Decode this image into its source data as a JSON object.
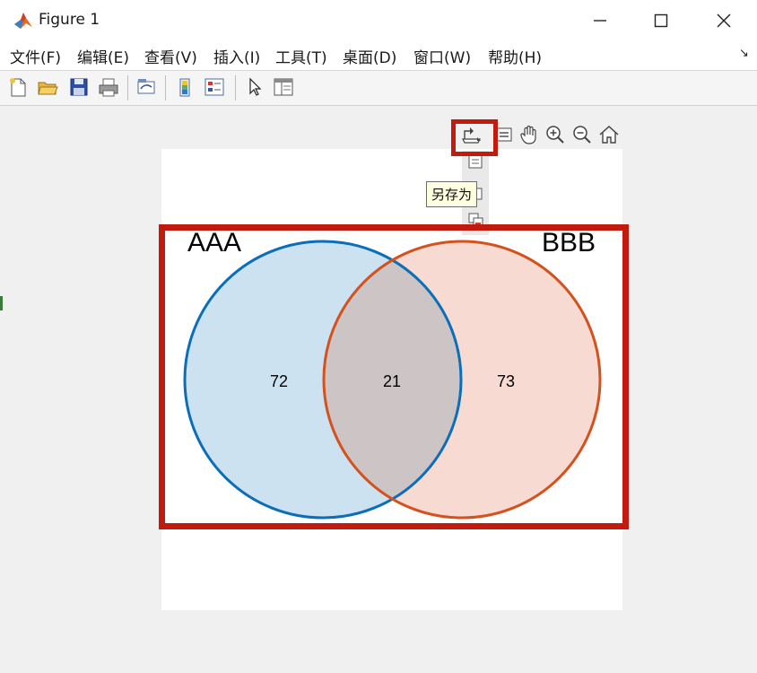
{
  "window": {
    "title": "Figure 1"
  },
  "menu": [
    "文件(F)",
    "编辑(E)",
    "查看(V)",
    "插入(I)",
    "工具(T)",
    "桌面(D)",
    "窗口(W)",
    "帮助(H)"
  ],
  "tooltip": "另存为",
  "venn": {
    "sets": [
      {
        "label": "AAA",
        "only_count": "72",
        "fill": "#cce2f1",
        "stroke": "#0b6eb8"
      },
      {
        "label": "BBB",
        "only_count": "73",
        "fill": "#f7dbd2",
        "stroke": "#d4521d"
      }
    ],
    "overlap_count": "21",
    "overlap_fill": "#cdc4c6"
  },
  "colors": {
    "highlight": "#c11a0e"
  }
}
